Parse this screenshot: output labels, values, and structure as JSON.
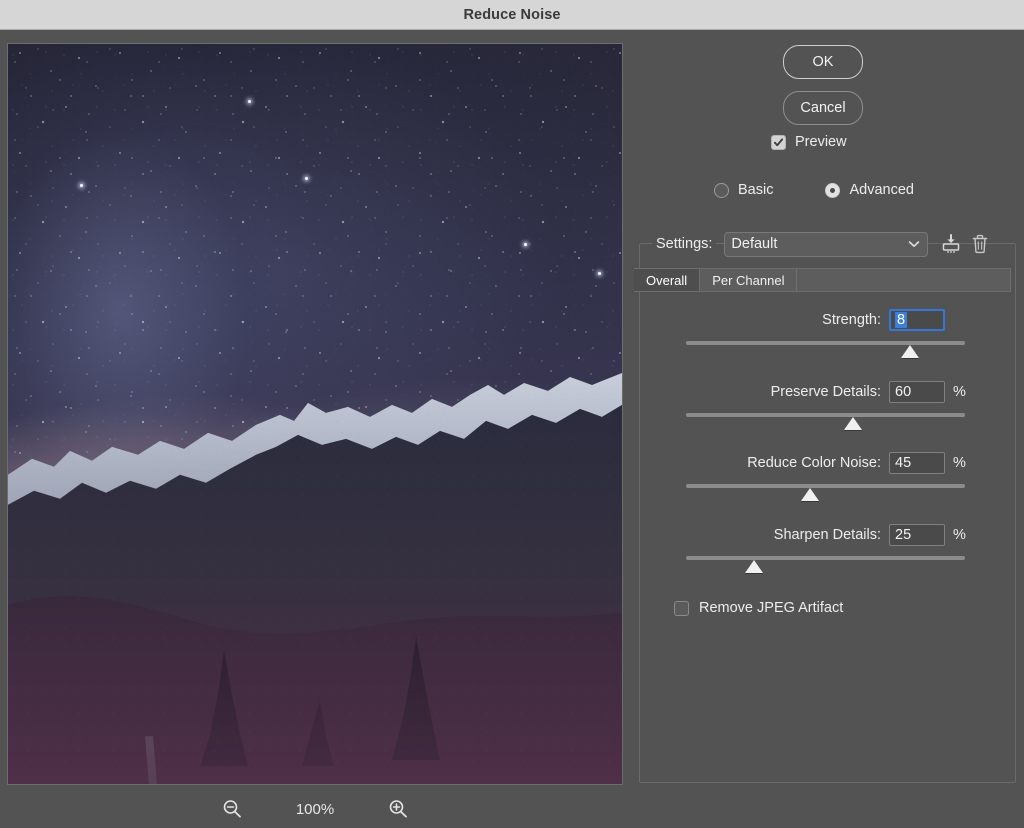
{
  "window": {
    "title": "Reduce Noise"
  },
  "preview": {
    "zoom_out_icon": "zoom-out-magnifier-icon",
    "zoom_level": "100%",
    "zoom_in_icon": "zoom-in-magnifier-icon",
    "image_description": "Night sky starfield with Milky Way over snow-capped mountain ridge"
  },
  "actions": {
    "ok_label": "OK",
    "cancel_label": "Cancel"
  },
  "preview_toggle": {
    "label": "Preview",
    "checked": true
  },
  "mode": {
    "basic_label": "Basic",
    "advanced_label": "Advanced",
    "selected": "Advanced"
  },
  "settings": {
    "label": "Settings:",
    "value": "Default",
    "options": [
      "Default"
    ],
    "save_icon": "save-preset-icon",
    "delete_icon": "trash-delete-preset-icon",
    "dropdown_icon": "chevron-down-icon"
  },
  "tabs": [
    {
      "label": "Overall",
      "active": true
    },
    {
      "label": "Per Channel",
      "active": false
    }
  ],
  "sliders": [
    {
      "label": "Strength:",
      "value": "8",
      "unit": "",
      "focused": true,
      "percent_position": 81,
      "min": 0,
      "max": 10
    },
    {
      "label": "Preserve Details:",
      "value": "60",
      "unit": "%",
      "focused": false,
      "percent_position": 60,
      "min": 0,
      "max": 100
    },
    {
      "label": "Reduce Color Noise:",
      "value": "45",
      "unit": "%",
      "focused": false,
      "percent_position": 45,
      "min": 0,
      "max": 100
    },
    {
      "label": "Sharpen Details:",
      "value": "25",
      "unit": "%",
      "focused": false,
      "percent_position": 25,
      "min": 0,
      "max": 100
    }
  ],
  "jpeg_artifact": {
    "label": "Remove JPEG Artifact",
    "checked": false
  },
  "colors": {
    "titlebar_bg": "#d6d6d7",
    "dialog_bg": "#535353",
    "accent_focus": "#3477d4",
    "selection_blue": "#3e7fd6",
    "text": "#ededed"
  }
}
